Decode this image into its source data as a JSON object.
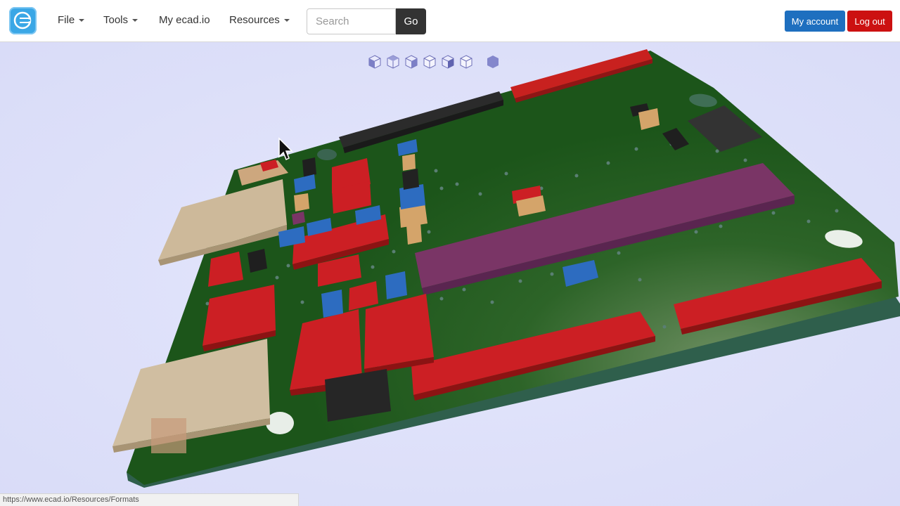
{
  "nav": {
    "logo": "ecad-logo-icon",
    "file_label": "File",
    "tools_label": "Tools",
    "my_ecad_label": "My ecad.io",
    "resources_label": "Resources",
    "search_placeholder": "Search",
    "go_label": "Go",
    "account_label": "My account",
    "logout_label": "Log out"
  },
  "viewer": {
    "view_cube_icons": [
      "cube-view-icon-1",
      "cube-view-icon-2",
      "cube-view-icon-3",
      "cube-view-icon-4",
      "cube-view-icon-5",
      "cube-view-icon-6",
      "hexagon-view-icon"
    ],
    "board_color": "#1e5a1c",
    "component_colors": {
      "red": "#cc1f24",
      "purple": "#7a3566",
      "tan": "#cdb99a",
      "blue": "#2d6cc0",
      "black": "#262626"
    }
  },
  "status_bar": {
    "url": "https://www.ecad.io/Resources/Formats"
  }
}
